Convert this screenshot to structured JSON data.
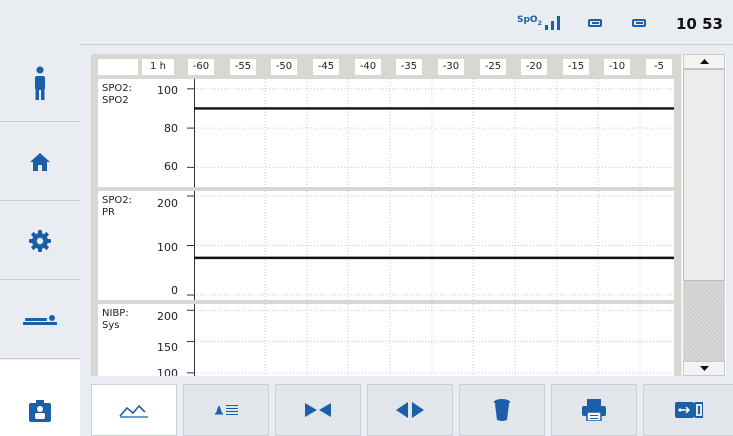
{
  "status_bar": {
    "spo2_label": "SpO",
    "spo2_sub": "2",
    "time": "10 53",
    "icons": [
      "spo2-signal-icon",
      "battery-icon",
      "battery-icon"
    ]
  },
  "sidebar": {
    "items": [
      {
        "name": "patient-info",
        "icon": "info-person-icon"
      },
      {
        "name": "home",
        "icon": "home-icon"
      },
      {
        "name": "settings",
        "icon": "gear-icon"
      },
      {
        "name": "patient-bed",
        "icon": "patient-bed-icon"
      },
      {
        "name": "trends",
        "icon": "trends-person-icon",
        "active": true
      }
    ]
  },
  "trend_view": {
    "time_axis": [
      "1 h",
      "-60",
      "-55",
      "-50",
      "-45",
      "-40",
      "-35",
      "-30",
      "-25",
      "-20",
      "-15",
      "-10",
      "-5"
    ],
    "panels": [
      {
        "label_line1": "SPO2:",
        "label_line2": "SPO2",
        "ticks": [
          "100",
          "80",
          "60"
        ],
        "y_min": 50,
        "y_max": 105,
        "value": 90
      },
      {
        "label_line1": "SPO2:",
        "label_line2": "PR",
        "ticks": [
          "200",
          "100",
          "0"
        ],
        "y_min": -10,
        "y_max": 210,
        "value": 75
      },
      {
        "label_line1": "NIBP:",
        "label_line2": "Sys",
        "ticks": [
          "200",
          "150",
          "100"
        ],
        "y_min": 95,
        "y_max": 210,
        "value": null
      }
    ]
  },
  "toolbar": {
    "items": [
      {
        "name": "trend-graph",
        "icon": "trend-graph-icon",
        "active": true
      },
      {
        "name": "alarm-limits",
        "icon": "alarm-limits-icon"
      },
      {
        "name": "zoom-in-time",
        "icon": "collapse-arrows-icon"
      },
      {
        "name": "zoom-out-time",
        "icon": "expand-arrows-icon"
      },
      {
        "name": "delete-trends",
        "icon": "trash-icon"
      },
      {
        "name": "print",
        "icon": "printer-icon"
      },
      {
        "name": "export-usb",
        "icon": "usb-icon"
      }
    ]
  },
  "colors": {
    "accent": "#1a5fa8",
    "background": "#e9edf2",
    "trend_line": "#111111"
  }
}
